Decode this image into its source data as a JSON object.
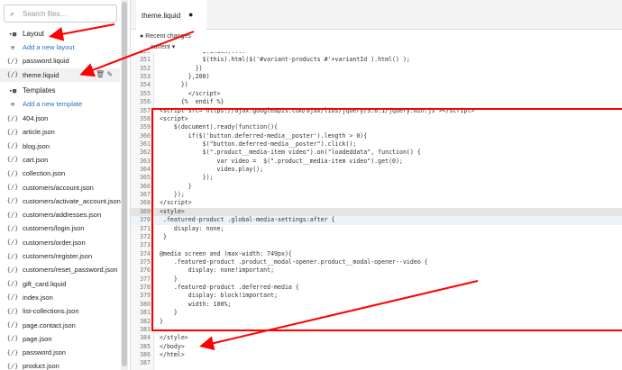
{
  "search": {
    "placeholder": "Search files..."
  },
  "sidebar": {
    "layout_label": "Layout",
    "add_layout": "Add a new layout",
    "layout_files": [
      "password.liquid",
      "theme.liquid"
    ],
    "templates_label": "Templates",
    "add_template": "Add a new template",
    "template_files": [
      "404.json",
      "article.json",
      "blog.json",
      "cart.json",
      "collection.json",
      "customers/account.json",
      "customers/activate_account.json",
      "customers/addresses.json",
      "customers/login.json",
      "customers/order.json",
      "customers/register.json",
      "customers/reset_password.json",
      "gift_card.liquid",
      "index.json",
      "list-collections.json",
      "page.contact.json",
      "page.json",
      "password.json",
      "product.json"
    ]
  },
  "editor": {
    "tab": "theme.liquid",
    "unsaved_dot": "●",
    "recent_changes": "Recent changes",
    "current": "current ▾",
    "lines": [
      {
        "n": "350",
        "t": "            $(index)...."
      },
      {
        "n": "351",
        "t": "            $(this).html($('#variant-products #'+variantId ).html() );"
      },
      {
        "n": "352",
        "t": "          })"
      },
      {
        "n": "353",
        "t": "        },200)"
      },
      {
        "n": "354",
        "t": "      })"
      },
      {
        "n": "355",
        "t": "        </script>"
      },
      {
        "n": "356",
        "t": "      {%  endif %}"
      },
      {
        "n": "357",
        "t": "<script src=\"https://ajax.googleapis.com/ajax/libs/jquery/3.6.1/jquery.min.js\"></script>"
      },
      {
        "n": "358",
        "t": "<script>"
      },
      {
        "n": "359",
        "t": "    $(document).ready(function(){"
      },
      {
        "n": "360",
        "t": "        if($('button.deferred-media__poster').length > 0){"
      },
      {
        "n": "361",
        "t": "            $(\"button.deferred-media__poster\").click();"
      },
      {
        "n": "362",
        "t": "            $(\".product__media-item video\").on(\"loadeddata\", function() {"
      },
      {
        "n": "363",
        "t": "                var video =  $(\".product__media-item video\").get(0);"
      },
      {
        "n": "364",
        "t": "                video.play();"
      },
      {
        "n": "365",
        "t": "            });"
      },
      {
        "n": "366",
        "t": "        }"
      },
      {
        "n": "367",
        "t": "    });"
      },
      {
        "n": "368",
        "t": "</script>"
      },
      {
        "n": "369",
        "t": "<style>"
      },
      {
        "n": "370",
        "t": " .featured-product .global-media-settings:after {"
      },
      {
        "n": "371",
        "t": "    display: none;"
      },
      {
        "n": "372",
        "t": " }"
      },
      {
        "n": "373",
        "t": ""
      },
      {
        "n": "374",
        "t": "@media screen and (max-width: 749px){"
      },
      {
        "n": "375",
        "t": "    .featured-product .product__modal-opener.product__modal-opener--video {"
      },
      {
        "n": "376",
        "t": "        display: none!important;"
      },
      {
        "n": "377",
        "t": "    }"
      },
      {
        "n": "378",
        "t": "    .featured-product .deferred-media {"
      },
      {
        "n": "379",
        "t": "        display: block!important;"
      },
      {
        "n": "380",
        "t": "        width: 100%;"
      },
      {
        "n": "381",
        "t": "    }"
      },
      {
        "n": "382",
        "t": "}"
      },
      {
        "n": "383",
        "t": ""
      },
      {
        "n": "384",
        "t": "</style>"
      },
      {
        "n": "385",
        "t": "</body>"
      },
      {
        "n": "386",
        "t": "</html>"
      },
      {
        "n": "387",
        "t": ""
      }
    ]
  },
  "colors": {
    "annotation": "#ff0000",
    "link": "#2c6ecb"
  }
}
